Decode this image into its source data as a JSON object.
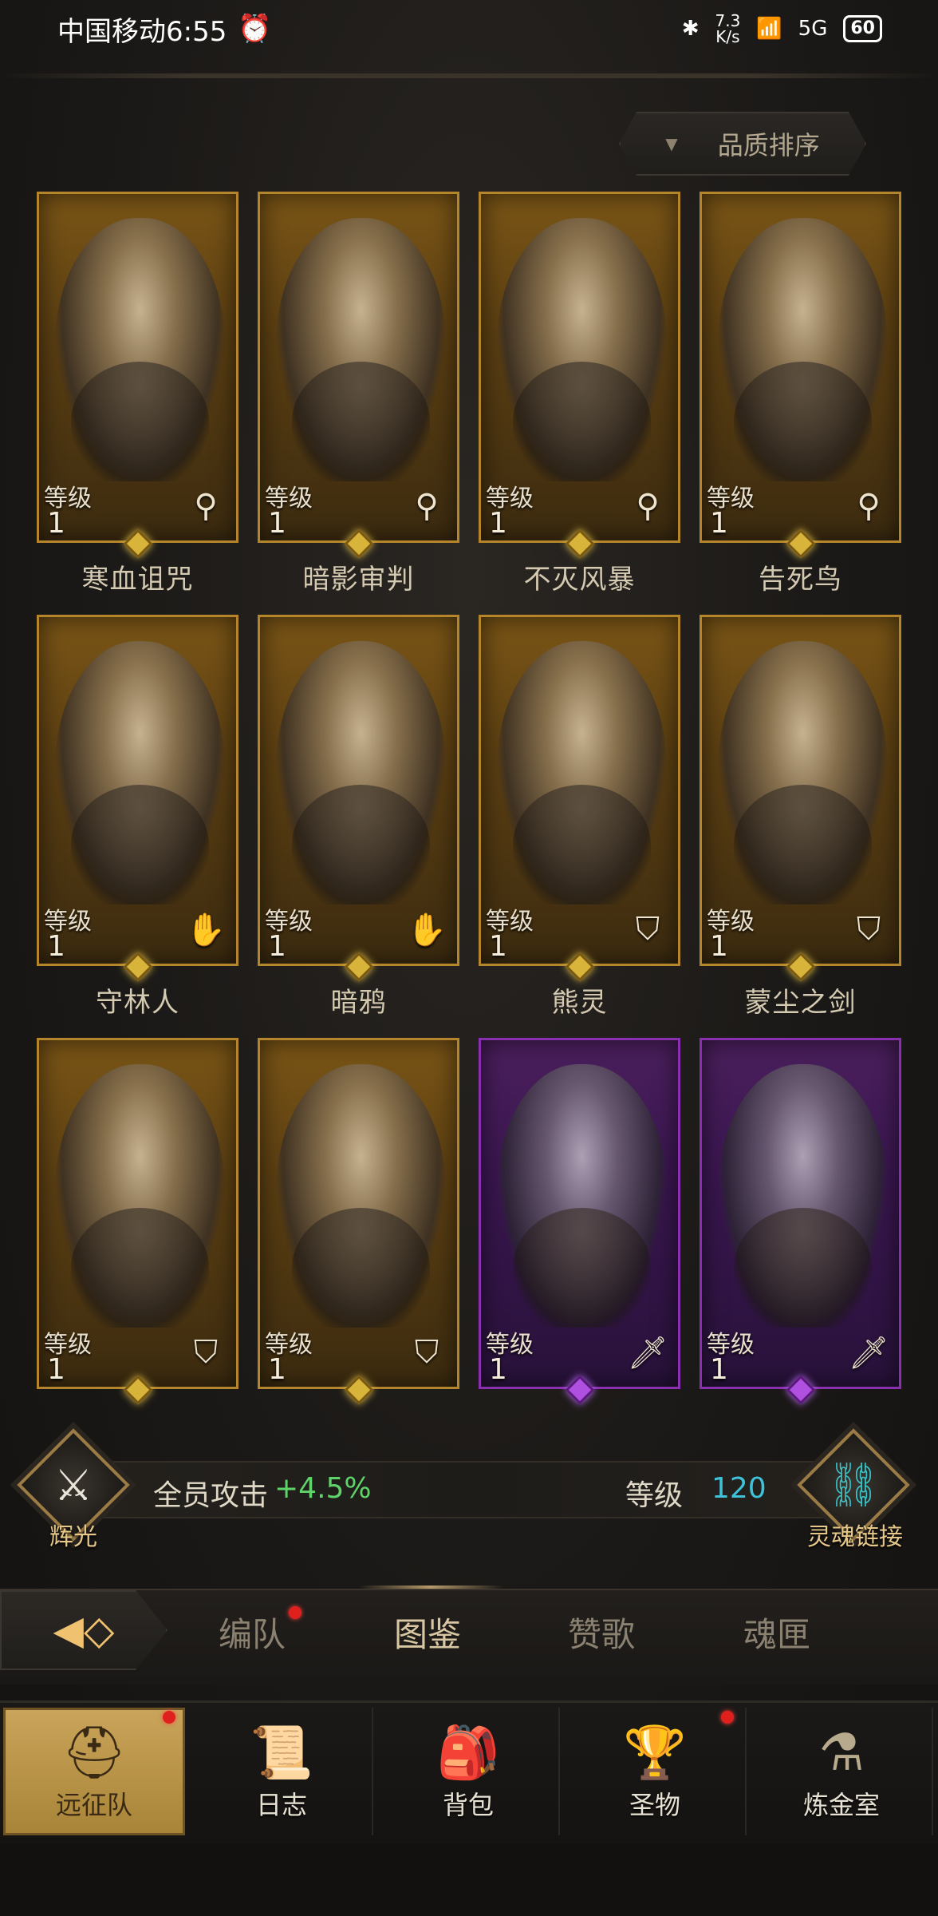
{
  "status_bar": {
    "carrier_time": "中国移动6:55",
    "alarm_icon": "alarm-clock-icon",
    "net_speed_value": "7.3",
    "net_speed_unit": "K/s",
    "network": "5G",
    "battery": "60"
  },
  "sort_button": {
    "label": "品质排序",
    "icon": "triangle-down-icon"
  },
  "heroes": [
    {
      "name": "寒血诅咒",
      "level_label": "等级",
      "level": "1",
      "class_icon": "staff-icon",
      "rarity": "gold"
    },
    {
      "name": "暗影审判",
      "level_label": "等级",
      "level": "1",
      "class_icon": "staff-icon",
      "rarity": "gold"
    },
    {
      "name": "不灭风暴",
      "level_label": "等级",
      "level": "1",
      "class_icon": "staff-icon",
      "rarity": "gold"
    },
    {
      "name": "告死鸟",
      "level_label": "等级",
      "level": "1",
      "class_icon": "staff-icon",
      "rarity": "gold"
    },
    {
      "name": "守林人",
      "level_label": "等级",
      "level": "1",
      "class_icon": "hand-icon",
      "rarity": "gold"
    },
    {
      "name": "暗鸦",
      "level_label": "等级",
      "level": "1",
      "class_icon": "hand-icon",
      "rarity": "gold"
    },
    {
      "name": "熊灵",
      "level_label": "等级",
      "level": "1",
      "class_icon": "shield-icon",
      "rarity": "gold"
    },
    {
      "name": "蒙尘之剑",
      "level_label": "等级",
      "level": "1",
      "class_icon": "shield-icon",
      "rarity": "gold"
    },
    {
      "name": "",
      "level_label": "等级",
      "level": "1",
      "class_icon": "shield-icon",
      "rarity": "gold"
    },
    {
      "name": "",
      "level_label": "等级",
      "level": "1",
      "class_icon": "shield-icon",
      "rarity": "gold"
    },
    {
      "name": "",
      "level_label": "等级",
      "level": "1",
      "class_icon": "sword-icon",
      "rarity": "purple"
    },
    {
      "name": "",
      "level_label": "等级",
      "level": "1",
      "class_icon": "sword-icon",
      "rarity": "purple"
    }
  ],
  "stats": {
    "glory_label": "辉光",
    "team_attack_label": "全员攻击",
    "team_attack_value": "+4.5%",
    "level_label": "等级",
    "level_value": "120",
    "soul_link_label": "灵魂链接"
  },
  "sub_tabs": {
    "back_icon": "arrow-left-icon",
    "items": [
      "编队",
      "图鉴",
      "赞歌",
      "魂匣"
    ],
    "active": "图鉴"
  },
  "bottom_nav": {
    "items": [
      {
        "label": "远征队",
        "icon": "viking-helmet-icon"
      },
      {
        "label": "日志",
        "icon": "scroll-icon"
      },
      {
        "label": "背包",
        "icon": "bag-icon"
      },
      {
        "label": "圣物",
        "icon": "chalice-icon"
      },
      {
        "label": "炼金室",
        "icon": "alchemy-icon"
      }
    ],
    "active": "远征队"
  },
  "colors": {
    "gold_border": "#b4852a",
    "purple_border": "#8a2fb0",
    "attack_green": "#5fd36a",
    "level_cyan": "#3fc2d8",
    "notify_red": "#e0201c"
  }
}
